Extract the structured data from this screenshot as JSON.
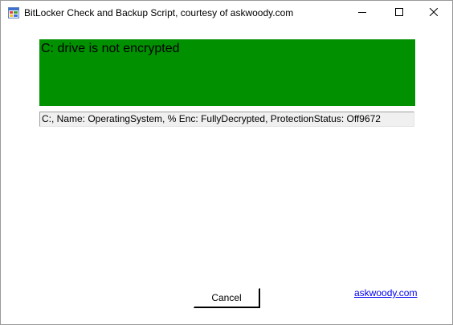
{
  "window": {
    "title": "BitLocker Check and Backup Script, courtesy of askwoody.com",
    "icon": "app-window-icon",
    "controls": {
      "minimize_icon": "minimize-icon",
      "maximize_icon": "maximize-icon",
      "close_icon": "close-icon"
    }
  },
  "banner": {
    "message": "C: drive is not encrypted",
    "background_color": "#009000"
  },
  "status": {
    "text": "C:, Name: OperatingSystem, % Enc: FullyDecrypted, ProtectionStatus: Off9672"
  },
  "buttons": {
    "cancel_label": "Cancel"
  },
  "link": {
    "label": "askwoody.com"
  }
}
